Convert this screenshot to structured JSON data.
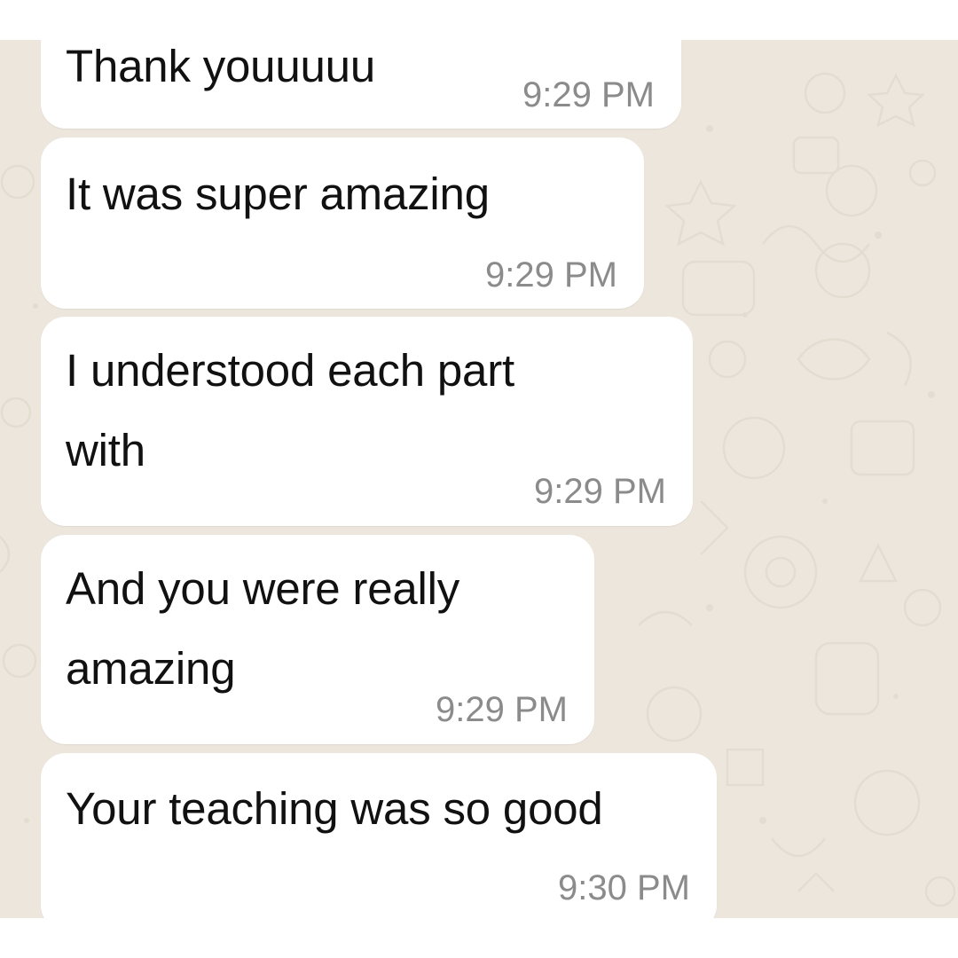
{
  "chat": {
    "background_color": "#ece6dc",
    "bubble_color": "#ffffff",
    "messages": [
      {
        "text": "Thank youuuuu",
        "time": "9:29 PM"
      },
      {
        "text": "It was super amazing",
        "time": "9:29 PM"
      },
      {
        "text": "I understood each part\nwith",
        "time": "9:29 PM"
      },
      {
        "text": "And you were really\namazing",
        "time": "9:29 PM"
      },
      {
        "text": "Your teaching was so good",
        "time": "9:30 PM"
      }
    ]
  }
}
